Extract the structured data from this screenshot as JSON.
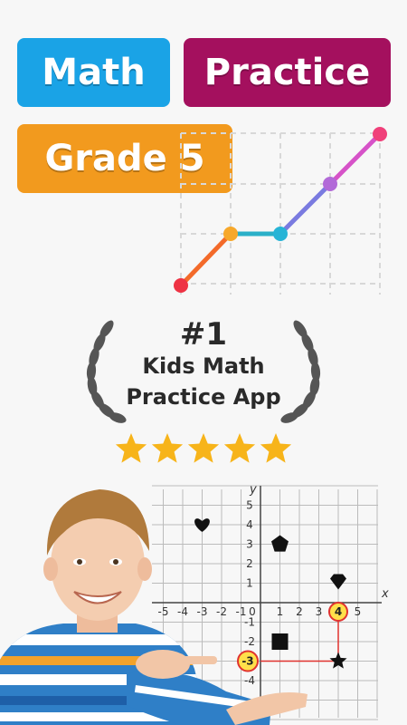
{
  "title": {
    "word1": "Math",
    "word2": "Practice",
    "grade": "Grade 5"
  },
  "colors": {
    "math_pill": "#1aa3e6",
    "practice_pill": "#a4105e",
    "grade_pill": "#f29a1e",
    "laurel": "#555555",
    "star": "#f7b41a"
  },
  "badge": {
    "rank": "#1",
    "line1": "Kids Math",
    "line2": "Practice App"
  },
  "rating": {
    "stars": 5,
    "max": 5
  },
  "coordinate_plane": {
    "x_label": "x",
    "y_label": "y",
    "x_ticks": [
      "-5",
      "-4",
      "-3",
      "-2",
      "-1",
      "0",
      "1",
      "2",
      "3",
      "4",
      "5"
    ],
    "y_ticks": [
      "5",
      "4",
      "3",
      "2",
      "1",
      "-1",
      "-2",
      "-3",
      "-4"
    ],
    "highlight_x": "4",
    "highlight_y": "-3",
    "shapes": [
      {
        "name": "heart",
        "x": -3,
        "y": 4
      },
      {
        "name": "pentagon",
        "x": 1,
        "y": 3
      },
      {
        "name": "diamond",
        "x": 4,
        "y": 1
      },
      {
        "name": "square",
        "x": 1,
        "y": -2
      },
      {
        "name": "star",
        "x": 4,
        "y": -3
      }
    ]
  }
}
